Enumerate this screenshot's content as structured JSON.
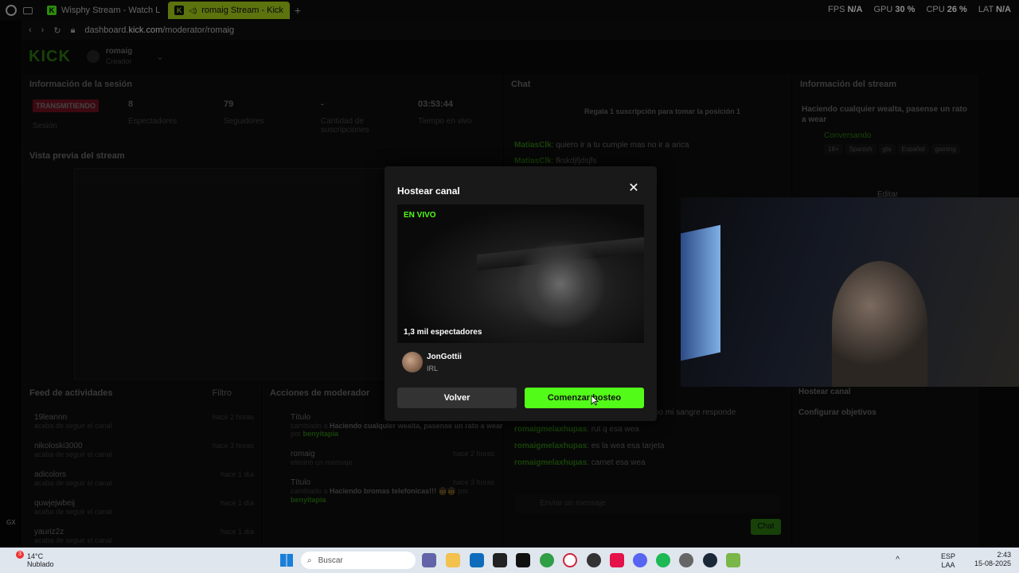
{
  "browser": {
    "tabs": [
      {
        "title": "Wisphy Stream - Watch L"
      },
      {
        "title": "romaig Stream - Kick"
      }
    ],
    "url_prefix": "dashboard.",
    "url_host": "kick.com",
    "url_path": "/moderator/romaig",
    "hud": {
      "fps_label": "FPS",
      "fps_value": "N/A",
      "gpu_label": "GPU",
      "gpu_value": "30 %",
      "cpu_label": "CPU",
      "cpu_value": "26 %",
      "lat_label": "LAT",
      "lat_value": "N/A"
    },
    "gx_label": "GX"
  },
  "kick": {
    "logo": "KICK",
    "channel": "romaig",
    "role": "Creador"
  },
  "session": {
    "title": "Información de la sesión",
    "status_badge": "TRANSMITIENDO",
    "status_label": "Sesión",
    "viewers": "8",
    "viewers_label": "Espectadores",
    "followers": "79",
    "followers_label": "Seguidores",
    "subs": "-",
    "subs_label": "Cantidad de suscripciones",
    "uptime": "03:53:44",
    "uptime_label": "Tiempo en vivo"
  },
  "preview_panel": {
    "title": "Vista previa del stream"
  },
  "activity": {
    "title": "Feed de actividades",
    "filter": "Filtro",
    "items": [
      {
        "name": "19leannn",
        "sub": "acaba de seguir el canal",
        "time": "hace 2 horas"
      },
      {
        "name": "nikoloski3000",
        "sub": "acaba de seguir el canal",
        "time": "hace 3 horas"
      },
      {
        "name": "adicolors",
        "sub": "acaba de seguir el canal",
        "time": "hace 1 día"
      },
      {
        "name": "quwjejwbeij",
        "sub": "acaba de seguir el canal",
        "time": "hace 1 día"
      },
      {
        "name": "yauriz2z",
        "sub": "acaba de seguir el canal",
        "time": "hace 1 día"
      }
    ]
  },
  "modactions": {
    "title": "Acciones de moderador",
    "items": [
      {
        "title": "Título",
        "prefix": "cambiado a",
        "detail": "Haciendo cualquier wealta, pasense un rato a wear",
        "by": "por",
        "user": "benyitapia",
        "time": ""
      },
      {
        "title": "romaig",
        "prefix": "",
        "detail": "eliminó un mensaje",
        "by": "",
        "user": "",
        "time": "hace 2 horas"
      },
      {
        "title": "Título",
        "prefix": "cambiado a",
        "detail": "Haciendo bromas telefonicas!!! 🤠🤠",
        "by": "por",
        "user": "benyitapia",
        "time": "hace 3 horas"
      }
    ]
  },
  "chat": {
    "title": "Chat",
    "banner": "Regala 1 suscripción para tomar la posición 1",
    "messages": [
      {
        "user": "MatiasClk",
        "text": ": quiero ir a tu cumple mas no ir a arica"
      },
      {
        "user": "MatiasClk",
        "text": ": fkskdjfjdsjfs"
      },
      {
        "user": "",
        "text": "po mi sangre responde"
      },
      {
        "user": "romaigmelaxhupas",
        "text": ": rut q esa wea"
      },
      {
        "user": "romaigmelaxhupas",
        "text": ": es la wea esa tarjeta"
      },
      {
        "user": "romaigmelaxhupas",
        "text": ": carnet esa wea"
      }
    ],
    "input_placeholder": "Enviar un mensaje",
    "send": "Chat"
  },
  "streaminfo": {
    "title": "Información del stream",
    "stream_title": "Haciendo cualquier wealta, pasense un rato a wear",
    "category": "Conversando",
    "tags": [
      "18+",
      "Spanish",
      "gta",
      "Español",
      "gaming"
    ],
    "edit": "Editar",
    "host": "Hostear canal",
    "goals": "Configurar objetivos"
  },
  "modal": {
    "title": "Hostear canal",
    "live": "EN VIVO",
    "viewers": "1,3 mil espectadores",
    "channel": "JonGottii",
    "category": "IRL",
    "back": "Volver",
    "start": "Comenzar hosteo"
  },
  "taskbar": {
    "weather_temp": "14°C",
    "weather_desc": "Nublado",
    "weather_badge": "3",
    "search": "Buscar",
    "lang": "ESP",
    "lang2": "LAA",
    "time": "2:43",
    "date": "15-08-2025"
  }
}
